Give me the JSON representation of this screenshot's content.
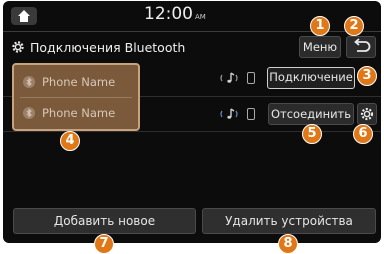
{
  "status_bar": {
    "time": "12:00",
    "ampm": "AM"
  },
  "header": {
    "title": "Подключения Bluetooth",
    "menu_label": "Меню"
  },
  "devices": [
    {
      "name": "Phone Name",
      "action_label": "Подключение"
    },
    {
      "name": "Phone Name",
      "action_label": "Отсоединить"
    }
  ],
  "bottom": {
    "add_label": "Добавить новое",
    "delete_label": "Удалить устройства"
  },
  "callouts": [
    "1",
    "2",
    "3",
    "4",
    "5",
    "6",
    "7",
    "8"
  ],
  "colors": {
    "background": "#0c0c0c",
    "selection_fill": "#7a5a3a",
    "selection_border": "#c7a27c",
    "callout": "#e07818"
  }
}
